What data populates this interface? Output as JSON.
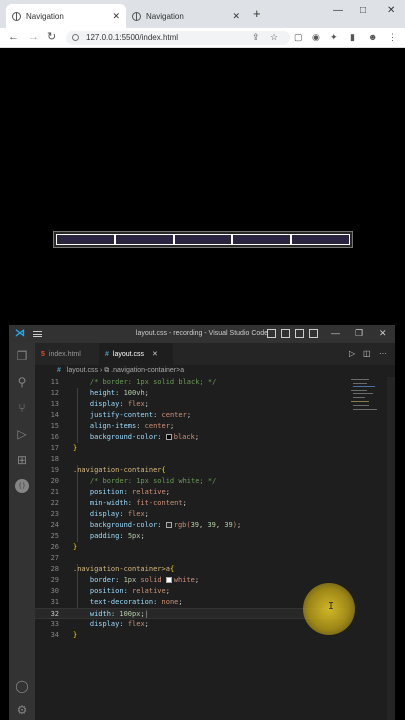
{
  "browser": {
    "tabs": [
      {
        "label": "Navigation",
        "active": true
      },
      {
        "label": "Navigation",
        "active": false
      }
    ],
    "url": "127.0.0.1:5500/index.html",
    "new_tab_icon": "+",
    "window_controls": [
      "—",
      "□",
      "✕"
    ]
  },
  "preview": {
    "nav_links": 5
  },
  "vscode": {
    "title": "layout.css - recording - Visual Studio Code",
    "tabs": [
      {
        "label": "index.html",
        "badge": "5",
        "active": false
      },
      {
        "label": "layout.css",
        "badge": "#",
        "active": true
      }
    ],
    "breadcrumb": [
      "layout.css",
      ".navigation-container>a"
    ],
    "code_lines": [
      {
        "n": "11",
        "html": ""
      },
      {
        "n": "12",
        "text": "    height: 100vh;"
      },
      {
        "n": "13",
        "text": "    display: flex;"
      },
      {
        "n": "14",
        "text": "    justify-content: center;"
      },
      {
        "n": "15",
        "text": "    align-items: center;"
      },
      {
        "n": "16",
        "text": "    background-color: black;"
      },
      {
        "n": "17",
        "text": "}"
      },
      {
        "n": "18",
        "text": ""
      },
      {
        "n": "19",
        "text": ".navigation-container{"
      },
      {
        "n": "20",
        "text": "    /* border: 1px solid white; */"
      },
      {
        "n": "21",
        "text": "    position: relative;"
      },
      {
        "n": "22",
        "text": "    min-width: fit-content;"
      },
      {
        "n": "23",
        "text": "    display: flex;"
      },
      {
        "n": "24",
        "text": "    background-color: rgb(39, 39, 39);"
      },
      {
        "n": "25",
        "text": "    padding: 5px;"
      },
      {
        "n": "26",
        "text": "}"
      },
      {
        "n": "27",
        "text": ""
      },
      {
        "n": "28",
        "text": ".navigation-container>a{"
      },
      {
        "n": "29",
        "text": "    border: 1px solid white;"
      },
      {
        "n": "30",
        "text": "    position: relative;"
      },
      {
        "n": "31",
        "text": "    text-decoration: none;"
      },
      {
        "n": "32",
        "text": "    width: 100px;"
      },
      {
        "n": "33",
        "text": "    display: flex;"
      },
      {
        "n": "34",
        "text": "}"
      }
    ],
    "current_line": "32"
  },
  "colors": {
    "accent": "#007acc",
    "swatch_black": "#000000",
    "swatch_white": "#ffffff",
    "swatch_rgb39": "#272727",
    "cursor_highlight": "#d8be28"
  },
  "icons": [
    "explorer-icon",
    "search-icon",
    "source-control-icon",
    "run-debug-icon",
    "extensions-icon",
    "json-icon",
    "account-icon",
    "settings-gear-icon"
  ]
}
